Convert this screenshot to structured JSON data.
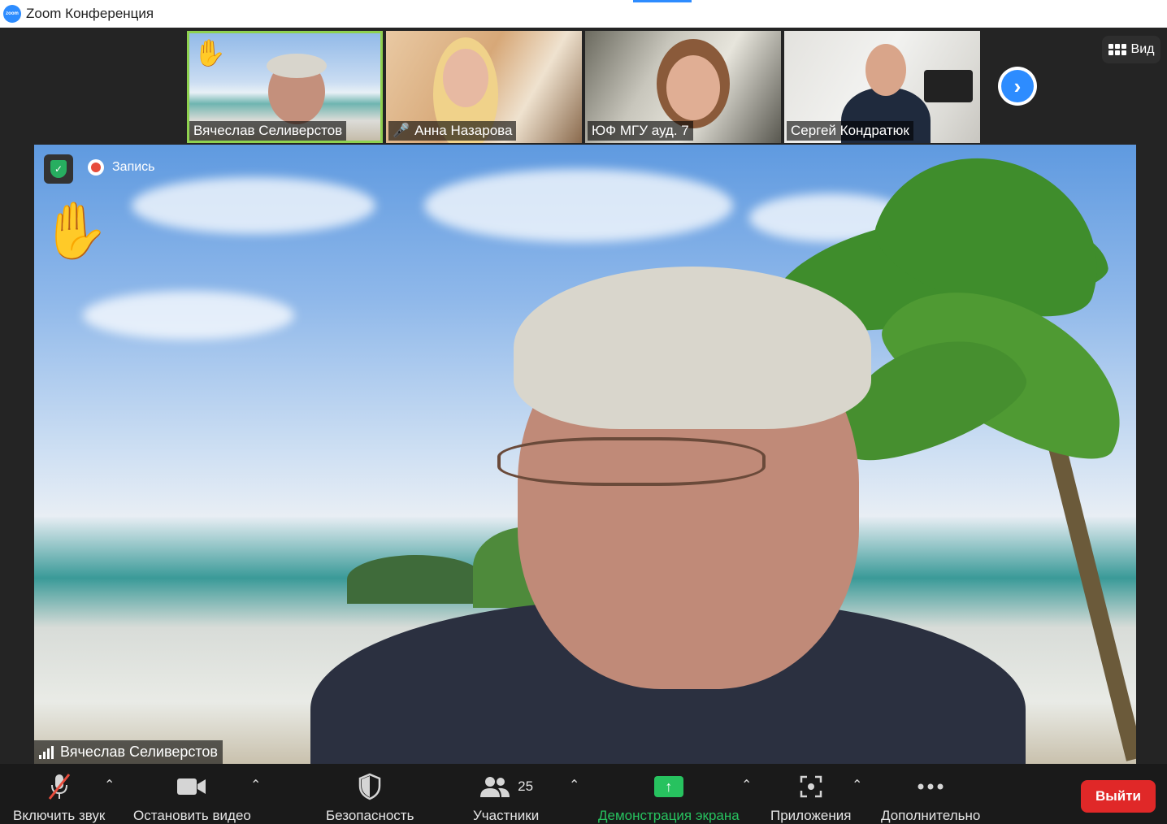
{
  "window": {
    "title": "Zoom Конференция",
    "logo_text": "zoom"
  },
  "view_button": {
    "label": "Вид"
  },
  "thumbnails": [
    {
      "name": "Вячеслав Селиверстов",
      "hand_raised": true,
      "muted": false
    },
    {
      "name": "Анна Назарова",
      "hand_raised": false,
      "muted": true
    },
    {
      "name": "ЮФ МГУ ауд. 7",
      "hand_raised": false,
      "muted": false
    },
    {
      "name": "Сергей Кондратюк",
      "hand_raised": false,
      "muted": false
    }
  ],
  "main_video": {
    "speaker_name": "Вячеслав Селиверстов",
    "recording_label": "Запись"
  },
  "toolbar": {
    "unmute_label": "Включить звук",
    "stop_video_label": "Остановить видео",
    "security_label": "Безопасность",
    "participants_label": "Участники",
    "participants_count": "25",
    "share_label": "Демонстрация экрана",
    "apps_label": "Приложения",
    "more_label": "Дополнительно",
    "leave_label": "Выйти"
  },
  "colors": {
    "accent_blue": "#2d8cff",
    "active_speaker_border": "#8fd14f",
    "share_green": "#27c25f",
    "leave_red": "#e02828"
  }
}
